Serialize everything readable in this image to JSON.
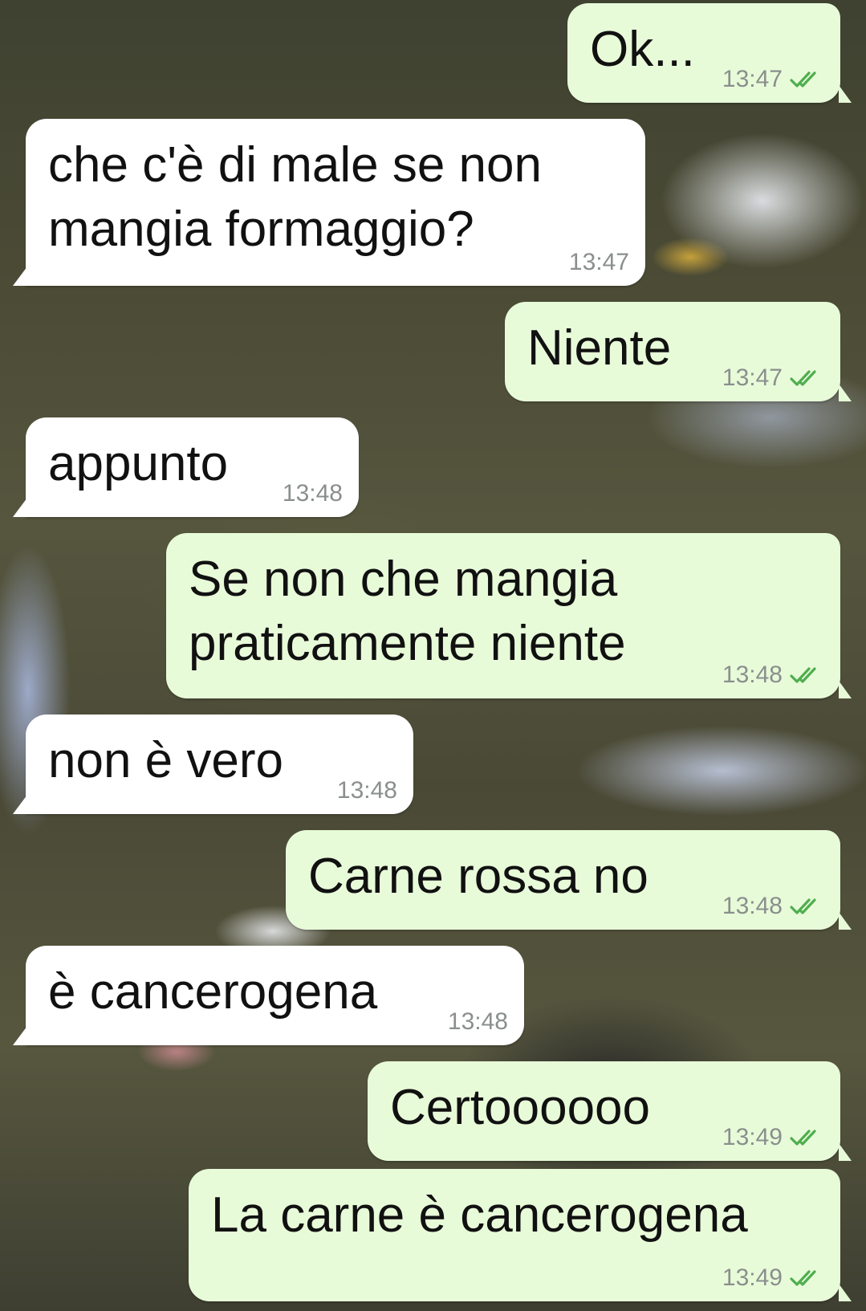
{
  "chat": {
    "messages": [
      {
        "direction": "out",
        "text": "Ok...",
        "time": "13:47",
        "status": "read-double-check-icon"
      },
      {
        "direction": "in",
        "text": "che c'è di male se non\nmangia formaggio?",
        "time": "13:47"
      },
      {
        "direction": "out",
        "text": "Niente",
        "time": "13:47",
        "status": "read-double-check-icon"
      },
      {
        "direction": "in",
        "text": "appunto",
        "time": "13:48"
      },
      {
        "direction": "out",
        "text": "Se non che mangia\npraticamente niente",
        "time": "13:48",
        "status": "read-double-check-icon"
      },
      {
        "direction": "in",
        "text": "non è vero",
        "time": "13:48"
      },
      {
        "direction": "out",
        "text": "Carne rossa no",
        "time": "13:48",
        "status": "read-double-check-icon"
      },
      {
        "direction": "in",
        "text": "è cancerogena",
        "time": "13:48"
      },
      {
        "direction": "out",
        "text": "Certoooooo",
        "time": "13:49",
        "status": "read-double-check-icon"
      },
      {
        "direction": "out",
        "text": "La carne è cancerogena",
        "time": "13:49",
        "status": "read-double-check-icon"
      }
    ]
  },
  "colors": {
    "outgoing_bubble": "#e8fbd9",
    "incoming_bubble": "#ffffff",
    "read_ticks": "#4fae4e",
    "timestamp": "#8a8f8d"
  }
}
